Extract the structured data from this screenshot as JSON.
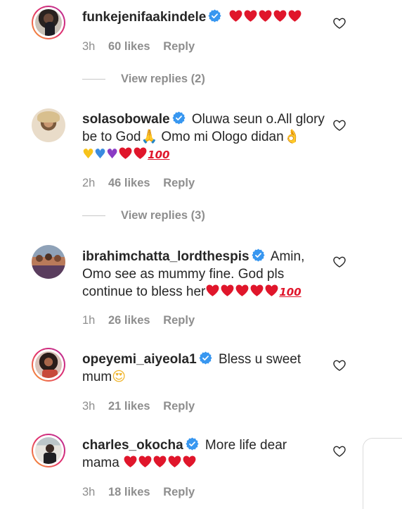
{
  "comments": [
    {
      "username": "funkejenifaakindele",
      "verified": true,
      "text": "",
      "emojis": "❤️❤️❤️❤️❤️",
      "time": "3h",
      "likes": "60 likes",
      "reply": "Reply",
      "view_replies": "View replies (2)"
    },
    {
      "username": "solasobowale",
      "verified": true,
      "text_part1": "Oluwa seun o.All glory be to God",
      "text_part2": " Omo mi Ologo didan",
      "time": "2h",
      "likes": "46 likes",
      "reply": "Reply",
      "view_replies": "View replies (3)"
    },
    {
      "username": "ibrahimchatta_lordthespis",
      "verified": true,
      "text": "Amin, Omo see as mummy fine. God pls continue to bless her",
      "time": "1h",
      "likes": "26 likes",
      "reply": "Reply"
    },
    {
      "username": "opeyemi_aiyeola1",
      "verified": true,
      "text": "Bless u sweet mum",
      "time": "3h",
      "likes": "21 likes",
      "reply": "Reply"
    },
    {
      "username": "charles_okocha",
      "verified": true,
      "text": "More life dear mama",
      "time": "3h",
      "likes": "18 likes",
      "reply": "Reply"
    }
  ],
  "icons": {
    "verified": "verified-badge-icon",
    "like": "heart-outline-icon"
  },
  "colors": {
    "text": "#262626",
    "muted": "#8e8e8e",
    "verified_blue": "#3897f0",
    "heart_red": "#e0162b"
  }
}
